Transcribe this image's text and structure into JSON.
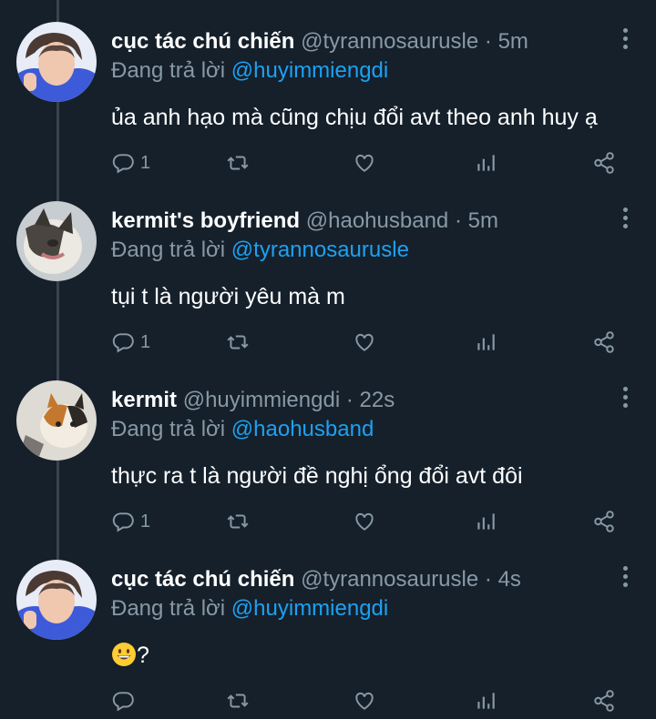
{
  "tweets": [
    {
      "name": "cục tác chú chiến",
      "handle": "@tyrannosaurusle",
      "time": "5m",
      "reply_prefix": "Đang trả lời",
      "reply_to": "@huyimmiengdi",
      "text": "ủa anh hạo mà cũng chịu đổi avt theo anh huy ạ",
      "reply_count": "1",
      "avatar": "person-avatar"
    },
    {
      "name": "kermit's boyfriend",
      "handle": "@haohusband",
      "time": "5m",
      "reply_prefix": "Đang trả lời",
      "reply_to": "@tyrannosaurusle",
      "text": "tụi t là người yêu mà m",
      "reply_count": "1",
      "avatar": "cat-avatar"
    },
    {
      "name": "kermit",
      "handle": "@huyimmiengdi",
      "time": "22s",
      "reply_prefix": "Đang trả lời",
      "reply_to": "@haohusband",
      "text": "thực ra t là người đề nghị ổng đổi avt đôi",
      "reply_count": "1",
      "avatar": "cat-avatar"
    },
    {
      "name": "cục tác chú chiến",
      "handle": "@tyrannosaurusle",
      "time": "4s",
      "reply_prefix": "Đang trả lời",
      "reply_to": "@huyimmiengdi",
      "text": "?",
      "reply_count": "",
      "avatar": "person-avatar",
      "emoji": "grinning-face-emoji"
    }
  ],
  "separator": "·",
  "icons": [
    "reply-icon",
    "retweet-icon",
    "like-icon",
    "analytics-icon",
    "share-icon",
    "more-icon"
  ],
  "colors": {
    "background": "#15202b",
    "secondary": "#8899a6",
    "link": "#1da1f2",
    "line": "#38444d"
  }
}
